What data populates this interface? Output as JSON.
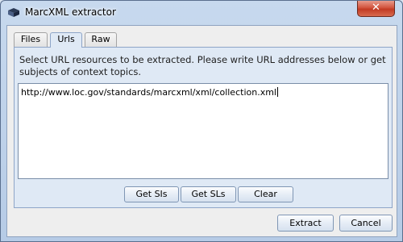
{
  "window": {
    "title": "MarcXML extractor",
    "close_glyph": "✕",
    "icon": "app-logo-icon"
  },
  "tabs": [
    {
      "label": "Files",
      "active": false
    },
    {
      "label": "Urls",
      "active": true
    },
    {
      "label": "Raw",
      "active": false
    }
  ],
  "panel": {
    "instructions": "Select URL resources to be extracted. Please write URL addresses below or get subjects of context topics.",
    "url_value": "http://www.loc.gov/standards/marcxml/xml/collection.xml"
  },
  "buttons": {
    "get_sis": "Get SIs",
    "get_sls": "Get SLs",
    "clear": "Clear",
    "extract": "Extract",
    "cancel": "Cancel"
  },
  "colors": {
    "titlebar": "#c7d9ee",
    "panel_bg": "#dfe9f5",
    "close_red": "#c23a23"
  }
}
